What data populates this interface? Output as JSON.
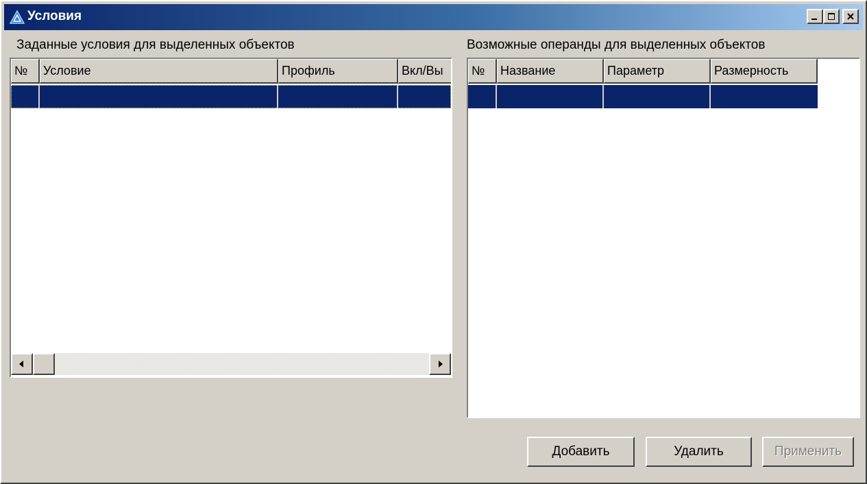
{
  "window": {
    "title": "Условия"
  },
  "left_panel": {
    "label": "Заданные условия для выделенных объектов",
    "columns": [
      "№",
      "Условие",
      "Профиль",
      "Вкл/Вы"
    ]
  },
  "right_panel": {
    "label": "Возможные операнды для выделенных объектов",
    "columns": [
      "№",
      "Название",
      "Параметр",
      "Размерность"
    ]
  },
  "buttons": {
    "add": "Добавить",
    "delete": "Удалить",
    "apply": "Применить"
  },
  "colors": {
    "selection": "#0a246a",
    "face": "#d4d0c8"
  }
}
